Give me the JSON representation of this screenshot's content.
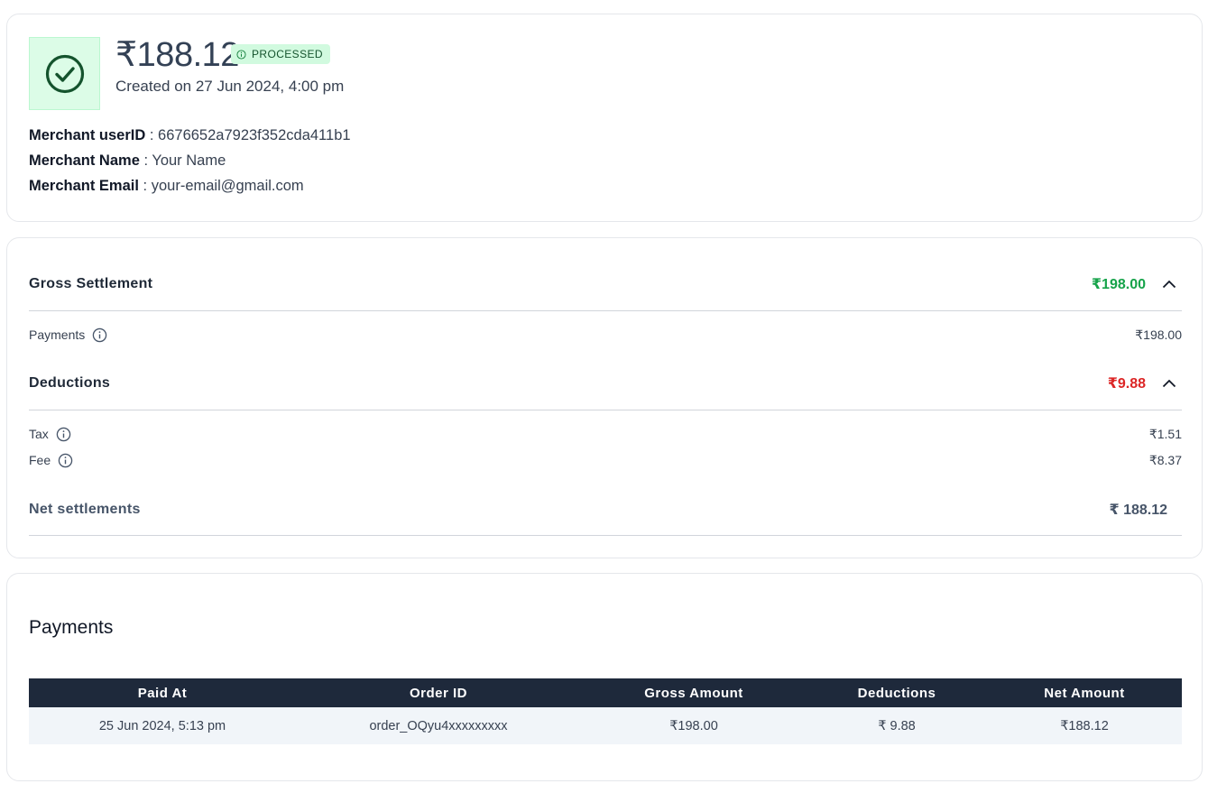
{
  "summary": {
    "amount": "₹188.12",
    "status": "PROCESSED",
    "created": "Created on 27 Jun 2024, 4:00 pm",
    "merchant_userid_label": "Merchant userID",
    "merchant_userid_value": " : 6676652a7923f352cda411b1",
    "merchant_name_label": "Merchant Name",
    "merchant_name_value": " : Your Name",
    "merchant_email_label": "Merchant Email",
    "merchant_email_value": " : your-email@gmail.com",
    "status_icon": "check-circle-icon"
  },
  "settlement": {
    "gross_label": "Gross Settlement",
    "gross_amount": "₹198.00",
    "payments_label": "Payments",
    "payments_amount": "₹198.00",
    "deductions_label": "Deductions",
    "deductions_amount": "₹9.88",
    "tax_label": "Tax",
    "tax_amount": "₹1.51",
    "fee_label": "Fee",
    "fee_amount": "₹8.37",
    "net_label": "Net settlements",
    "net_amount": "₹ 188.12"
  },
  "payments": {
    "title": "Payments",
    "columns": [
      "Paid At",
      "Order ID",
      "Gross Amount",
      "Deductions",
      "Net Amount"
    ],
    "rows": [
      [
        "25 Jun 2024, 5:13 pm",
        "order_OQyu4xxxxxxxxx",
        "₹198.00",
        "₹ 9.88",
        "₹188.12"
      ]
    ]
  },
  "colors": {
    "positive": "#16a34a",
    "negative": "#dc2626",
    "header_bg": "#1e293b",
    "status_bg": "#dcfce7"
  }
}
